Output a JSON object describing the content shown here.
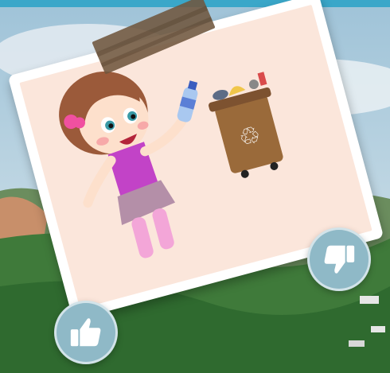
{
  "app": {
    "accent_color": "#3aa7c9"
  },
  "scene": {
    "card": {
      "bin_symbol": "♲",
      "bin_color": "#9a6a3a",
      "girl_shirt_color": "#c243c7",
      "background_color": "#fbe6db"
    }
  },
  "controls": {
    "thumbs_up_icon": "thumbs-up-icon",
    "thumbs_down_icon": "thumbs-down-icon",
    "button_color": "#8fb9c7"
  }
}
